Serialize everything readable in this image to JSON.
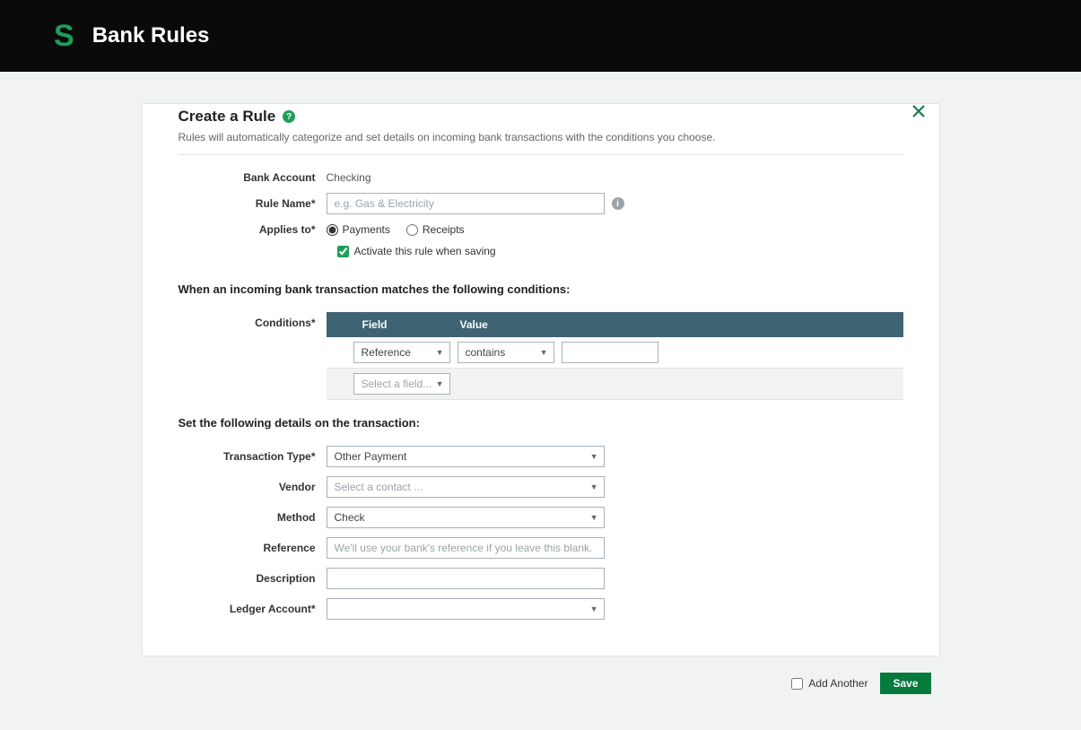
{
  "header": {
    "title": "Bank Rules"
  },
  "card": {
    "title": "Create a Rule",
    "subtitle": "Rules will automatically categorize and set details on incoming bank transactions with the conditions you choose."
  },
  "labels": {
    "bank_account": "Bank Account",
    "rule_name": "Rule Name*",
    "applies_to": "Applies to*",
    "conditions": "Conditions*",
    "transaction_type": "Transaction Type*",
    "vendor": "Vendor",
    "method": "Method",
    "reference": "Reference",
    "description": "Description",
    "ledger_account": "Ledger Account*"
  },
  "values": {
    "bank_account": "Checking",
    "rule_name_placeholder": "e.g. Gas & Electricity",
    "payments": "Payments",
    "receipts": "Receipts",
    "activate_label": "Activate this rule when saving",
    "cond_section_title": "When an incoming bank transaction matches the following conditions:",
    "cond_header_field": "Field",
    "cond_header_value": "Value",
    "cond_field_sel": "Reference",
    "cond_op_sel": "contains",
    "cond_add_placeholder": "Select a field...",
    "details_section_title": "Set the following details on the transaction:",
    "transaction_type_val": "Other Payment",
    "vendor_placeholder": "Select a contact ...",
    "method_val": "Check",
    "reference_placeholder": "We'll use your bank's reference if you leave this blank.",
    "add_another": "Add Another",
    "save": "Save"
  }
}
